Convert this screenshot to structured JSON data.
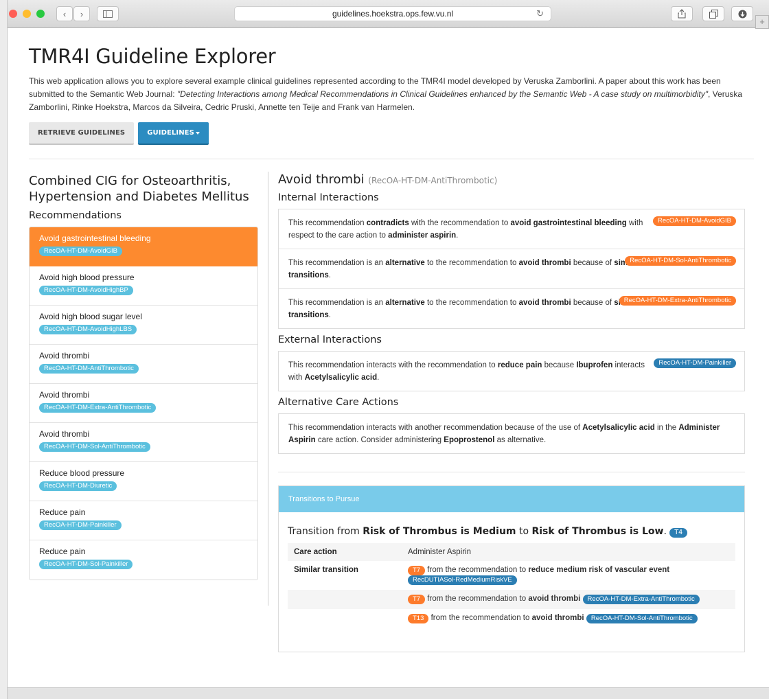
{
  "browser": {
    "url": "guidelines.hoekstra.ops.few.vu.nl",
    "traffic_lights": [
      "#ff5f57",
      "#ffbd2e",
      "#28c940"
    ]
  },
  "page": {
    "title": "TMR4I Guideline Explorer",
    "intro_part1": "This web application allows you to explore several example clinical guidelines represented according to the TMR4I model developed by Veruska Zamborlini. A paper about this work has been submitted to the Semantic Web Journal: ",
    "intro_italic": "\"Detecting Interactions among Medical Recommendations in Clinical Guidelines enhanced by the Semantic Web - A case study on multimorbidity\"",
    "intro_part2": ", Veruska Zamborlini, Rinke Hoekstra, Marcos da Silveira, Cedric Pruski, Annette ten Teije and Frank van Harmelen.",
    "retrieve_button": "RETRIEVE GUIDELINES",
    "guidelines_button": "GUIDELINES"
  },
  "left": {
    "cig_title": "Combined CIG for Osteoarthritis, Hypertension and Diabetes Mellitus",
    "recommendations_heading": "Recommendations",
    "items": [
      {
        "label": "Avoid gastrointestinal bleeding",
        "id": "RecOA-HT-DM-AvoidGIB",
        "active": true
      },
      {
        "label": "Avoid high blood pressure",
        "id": "RecOA-HT-DM-AvoidHighBP"
      },
      {
        "label": "Avoid high blood sugar level",
        "id": "RecOA-HT-DM-AvoidHighLBS"
      },
      {
        "label": "Avoid thrombi",
        "id": "RecOA-HT-DM-AntiThrombotic"
      },
      {
        "label": "Avoid thrombi",
        "id": "RecOA-HT-DM-Extra-AntiThrombotic"
      },
      {
        "label": "Avoid thrombi",
        "id": "RecOA-HT-DM-Sol-AntiThrombotic"
      },
      {
        "label": "Reduce blood pressure",
        "id": "RecOA-HT-DM-Diuretic"
      },
      {
        "label": "Reduce pain",
        "id": "RecOA-HT-DM-Painkiller"
      },
      {
        "label": "Reduce pain",
        "id": "RecOA-HT-DM-Sol-Painkiller"
      }
    ]
  },
  "right": {
    "rec_title": "Avoid thrombi",
    "rec_id": "(RecOA-HT-DM-AntiThrombotic)",
    "internal_heading": "Internal Interactions",
    "internal": [
      {
        "t1": "This recommendation ",
        "b1": "contradicts",
        "t2": " with the recommendation to ",
        "b2": "avoid gastrointestinal bleeding",
        "t3": " with respect to the care action to ",
        "b3": "administer aspirin",
        "t4": ".",
        "badge": "RecOA-HT-DM-AvoidGIB"
      },
      {
        "t1": "This recommendation is an ",
        "b1": "alternative",
        "t2": " to the recommendation to ",
        "b2": "avoid thrombi",
        "t3": " because of ",
        "b3": "similar transitions",
        "t4": ".",
        "badge": "RecOA-HT-DM-Sol-AntiThrombotic"
      },
      {
        "t1": "This recommendation is an ",
        "b1": "alternative",
        "t2": " to the recommendation to ",
        "b2": "avoid thrombi",
        "t3": " because of ",
        "b3": "similar transitions",
        "t4": ".",
        "badge": "RecOA-HT-DM-Extra-AntiThrombotic"
      }
    ],
    "external_heading": "External Interactions",
    "external": {
      "t1": "This recommendation interacts with the recommendation to ",
      "b1": "reduce pain",
      "t2": " because ",
      "b2": "Ibuprofen",
      "t3": " interacts with ",
      "b3": "Acetylsalicylic acid",
      "t4": ".",
      "badge": "RecOA-HT-DM-Painkiller"
    },
    "alt_heading": "Alternative Care Actions",
    "alt": {
      "t1": "This recommendation interacts with another recommendation because of the use of ",
      "b1": "Acetylsalicylic acid",
      "t2": " in the ",
      "b2": "Administer Aspirin",
      "t3": " care action. Consider administering ",
      "b3": "Epoprostenol",
      "t4": " as alternative."
    },
    "transitions": {
      "heading": "Transitions to Pursue",
      "t_prefix": "Transition from ",
      "from": "Risk of Thrombus is Medium",
      "t_mid": " to ",
      "to": "Risk of Thrombus is Low",
      "t_end": ".",
      "tag": "T4",
      "care_action_label": "Care action",
      "care_action_value": "Administer Aspirin",
      "similar_label": "Similar transition",
      "similar": [
        {
          "tag": "T7",
          "text": " from the recommendation to ",
          "bold": "reduce medium risk of vascular event",
          "rec": "RecDUTIASol-RedMediumRiskVE"
        },
        {
          "tag": "T7",
          "text": " from the recommendation to ",
          "bold": "avoid thrombi",
          "rec": "RecOA-HT-DM-Extra-AntiThrombotic"
        },
        {
          "tag": "T13",
          "text": " from the recommendation to ",
          "bold": "avoid thrombi",
          "rec": "RecOA-HT-DM-Sol-AntiThrombotic"
        }
      ]
    }
  }
}
